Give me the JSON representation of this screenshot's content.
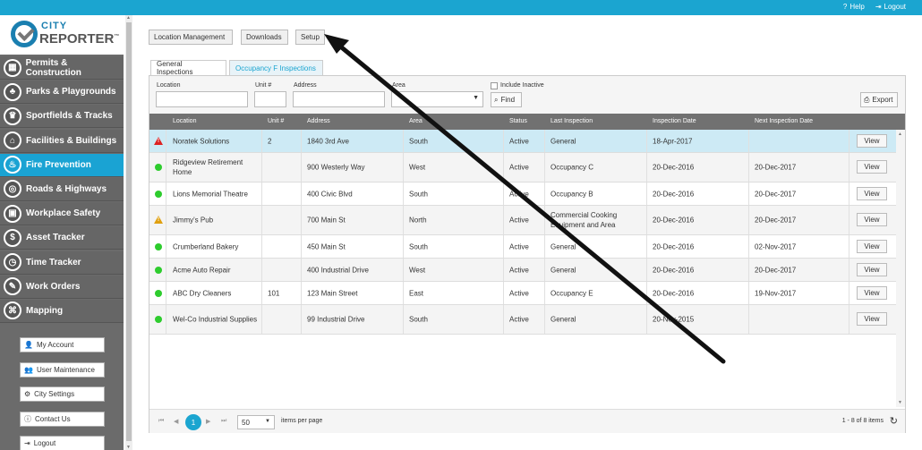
{
  "topbar": {
    "help": "Help",
    "logout": "Logout"
  },
  "logo": {
    "line1": "CITY",
    "line2": "REPORTER",
    "tm": "™"
  },
  "nav": [
    {
      "label": "Permits & Construction",
      "icon": "building-icon",
      "glyph": "▦"
    },
    {
      "label": "Parks & Playgrounds",
      "icon": "tree-icon",
      "glyph": "♣"
    },
    {
      "label": "Sportfields & Tracks",
      "icon": "trophy-icon",
      "glyph": "♛"
    },
    {
      "label": "Facilities & Buildings",
      "icon": "facility-icon",
      "glyph": "⌂"
    },
    {
      "label": "Fire Prevention",
      "icon": "fire-extinguisher-icon",
      "glyph": "♨"
    },
    {
      "label": "Roads & Highways",
      "icon": "traffic-light-icon",
      "glyph": "◎"
    },
    {
      "label": "Workplace Safety",
      "icon": "workplace-icon",
      "glyph": "▣"
    },
    {
      "label": "Asset Tracker",
      "icon": "dollar-icon",
      "glyph": "$"
    },
    {
      "label": "Time Tracker",
      "icon": "clock-icon",
      "glyph": "◷"
    },
    {
      "label": "Work Orders",
      "icon": "wrench-icon",
      "glyph": "✎"
    },
    {
      "label": "Mapping",
      "icon": "map-icon",
      "glyph": "⌘"
    }
  ],
  "side_buttons": [
    {
      "label": "My Account",
      "icon": "user-icon",
      "glyph": "👤"
    },
    {
      "label": "User Maintenance",
      "icon": "users-icon",
      "glyph": "👥"
    },
    {
      "label": "City Settings",
      "icon": "gear-icon",
      "glyph": "⚙"
    },
    {
      "label": "Contact Us",
      "icon": "info-icon",
      "glyph": "ⓘ"
    },
    {
      "label": "Logout",
      "icon": "logout-icon",
      "glyph": "⇥"
    }
  ],
  "toolbar": {
    "location_management": "Location Management",
    "downloads": "Downloads",
    "setup": "Setup"
  },
  "tabs": [
    "General Inspections",
    "Occupancy F Inspections"
  ],
  "filters": {
    "location_label": "Location",
    "unit_label": "Unit #",
    "address_label": "Address",
    "area_label": "Area",
    "include_inactive": "Include Inactive",
    "find": "Find",
    "export": "Export"
  },
  "columns": [
    "Location",
    "Unit #",
    "Address",
    "Area",
    "Status",
    "Last Inspection",
    "Inspection Date",
    "Next Inspection Date"
  ],
  "rows": [
    {
      "status_icon": "warning-red",
      "location": "Noratek Solutions",
      "unit": "2",
      "address": "1840 3rd Ave",
      "area": "South",
      "status": "Active",
      "last": "General",
      "date": "18-Apr-2017",
      "next": "",
      "view": "View"
    },
    {
      "status_icon": "ok",
      "location": "Ridgeview Retirement Home",
      "unit": "",
      "address": "900 Westerly Way",
      "area": "West",
      "status": "Active",
      "last": "Occupancy C",
      "date": "20-Dec-2016",
      "next": "20-Dec-2017",
      "view": "View"
    },
    {
      "status_icon": "ok",
      "location": "Lions Memorial Theatre",
      "unit": "",
      "address": "400 Civic Blvd",
      "area": "South",
      "status": "Active",
      "last": "Occupancy B",
      "date": "20-Dec-2016",
      "next": "20-Dec-2017",
      "view": "View"
    },
    {
      "status_icon": "warning-yellow",
      "location": "Jimmy's Pub",
      "unit": "",
      "address": "700 Main St",
      "area": "North",
      "status": "Active",
      "last": "Commercial Cooking Equipment and Area",
      "date": "20-Dec-2016",
      "next": "20-Dec-2017",
      "view": "View"
    },
    {
      "status_icon": "ok",
      "location": "Crumberland Bakery",
      "unit": "",
      "address": "450 Main St",
      "area": "South",
      "status": "Active",
      "last": "General",
      "date": "20-Dec-2016",
      "next": "02-Nov-2017",
      "view": "View"
    },
    {
      "status_icon": "ok",
      "location": "Acme Auto Repair",
      "unit": "",
      "address": "400 Industrial Drive",
      "area": "West",
      "status": "Active",
      "last": "General",
      "date": "20-Dec-2016",
      "next": "20-Dec-2017",
      "view": "View"
    },
    {
      "status_icon": "ok",
      "location": "ABC Dry Cleaners",
      "unit": "101",
      "address": "123 Main Street",
      "area": "East",
      "status": "Active",
      "last": "Occupancy E",
      "date": "20-Dec-2016",
      "next": "19-Nov-2017",
      "view": "View"
    },
    {
      "status_icon": "ok",
      "location": "Wel-Co Industrial Supplies",
      "unit": "",
      "address": "99 Industrial Drive",
      "area": "South",
      "status": "Active",
      "last": "General",
      "date": "20-Nov-2015",
      "next": "",
      "view": "View"
    }
  ],
  "pager": {
    "page": "1",
    "page_size": "50",
    "items_per_page": "items per page",
    "count": "1 - 8 of 8 items"
  },
  "colors": {
    "accent": "#1ba5d0",
    "sidebar": "#6b6b6b",
    "header": "#717171",
    "ok": "#2ecc2e",
    "warning": "#e0a010",
    "danger": "#d22222"
  }
}
